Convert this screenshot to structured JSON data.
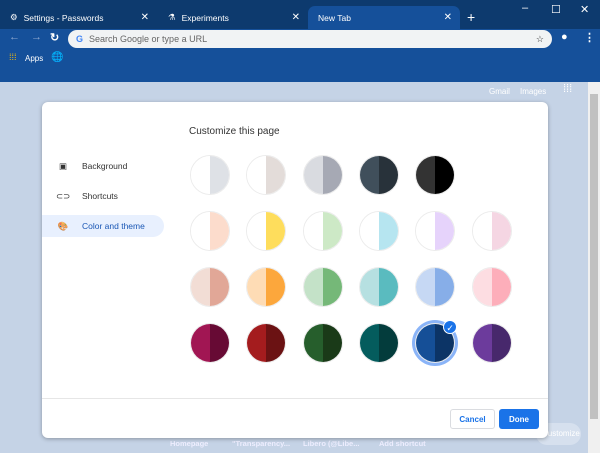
{
  "tabs": [
    {
      "label": "Settings - Passwords",
      "icon": "gear-icon"
    },
    {
      "label": "Experiments",
      "icon": "flask-icon"
    },
    {
      "label": "New Tab",
      "active": true
    }
  ],
  "omnibox": {
    "placeholder": "Search Google or type a URL"
  },
  "bookmarks": {
    "apps": "Apps"
  },
  "header_links": {
    "gmail": "Gmail",
    "images": "Images"
  },
  "dialog": {
    "title": "Customize this page",
    "nav": [
      {
        "label": "Background",
        "icon": "image-icon"
      },
      {
        "label": "Shortcuts",
        "icon": "link-icon"
      },
      {
        "label": "Color and theme",
        "icon": "palette-icon",
        "selected": true
      }
    ],
    "swatches": [
      [
        [
          "#ffffff",
          "#dee1e6"
        ],
        [
          "#ffffff",
          "#e3dcd9"
        ],
        [
          "#d9dbe0",
          "#a6a9b4"
        ],
        [
          "#404f5b",
          "#28323a"
        ],
        [
          "#333333",
          "#000000"
        ]
      ],
      [
        [
          "#ffffff",
          "#fcdccc"
        ],
        [
          "#ffffff",
          "#fedd5c"
        ],
        [
          "#ffffff",
          "#cde9c6"
        ],
        [
          "#ffffff",
          "#b6e5f0"
        ],
        [
          "#ffffff",
          "#e6d3fb"
        ],
        [
          "#ffffff",
          "#f5d6e3"
        ]
      ],
      [
        [
          "#f2ddd5",
          "#e1a797"
        ],
        [
          "#fedcb5",
          "#fca73c"
        ],
        [
          "#c4e2c8",
          "#75b878"
        ],
        [
          "#b6e0e1",
          "#5abbbf"
        ],
        [
          "#c6d8f4",
          "#87aee8"
        ],
        [
          "#fddde2",
          "#fdaeba"
        ]
      ],
      [
        [
          "#a11653",
          "#670a34"
        ],
        [
          "#a41c1e",
          "#6b1213"
        ],
        [
          "#265e2c",
          "#1a3a18"
        ],
        [
          "#045c5d",
          "#033c3c"
        ],
        [
          "#154f97",
          "#0c3466"
        ],
        [
          "#6c3b9c",
          "#47286c"
        ]
      ]
    ],
    "selected": [
      3,
      4
    ],
    "cancel": "Cancel",
    "done": "Done"
  },
  "shortcuts": [
    "Homepage",
    "\"Transparency...",
    "Libero (@Libe...",
    "Add shortcut"
  ],
  "customize": "Customize",
  "colors": {
    "frame": "#0d3a6e",
    "toolbar": "#15509a",
    "accent": "#1a73e8",
    "background": "#c5d3e6"
  }
}
